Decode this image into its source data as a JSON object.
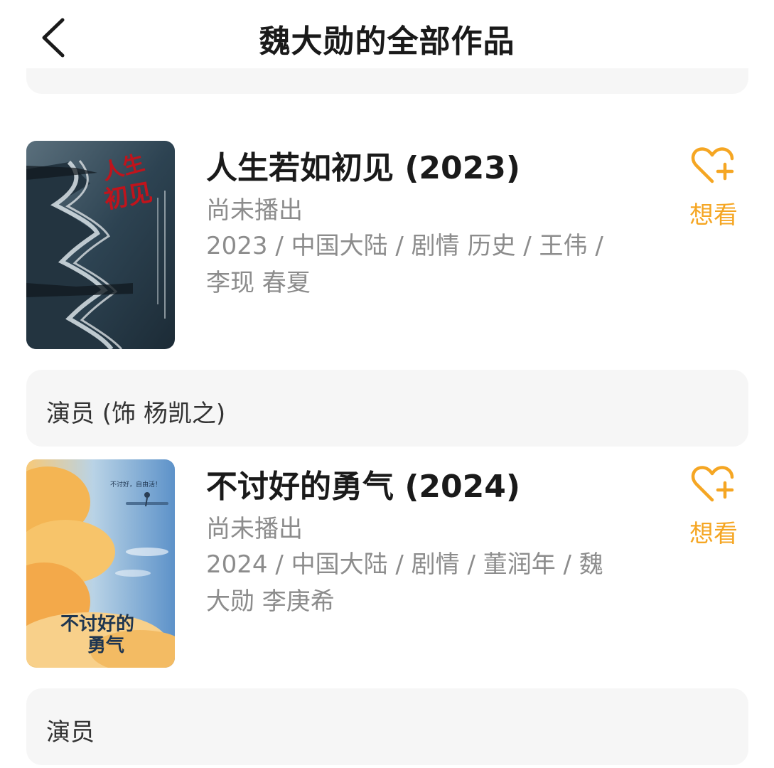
{
  "header": {
    "title": "魏大勋的全部作品"
  },
  "works": [
    {
      "title": "人生若如初见 (2023)",
      "status": "尚未播出",
      "meta": "2023 / 中国大陆 / 剧情 历史 / 王伟 / 李现 春夏",
      "want_label": "想看",
      "role": "演员 (饰 杨凯之)"
    },
    {
      "title": "不讨好的勇气 (2024)",
      "status": "尚未播出",
      "meta": "2024 / 中国大陆 / 剧情 / 董润年 / 魏大勋 李庚希",
      "want_label": "想看",
      "role": "演员"
    }
  ],
  "colors": {
    "accent": "#f5a623",
    "muted_text": "#8c8c8c",
    "panel_bg": "#f6f6f6"
  },
  "icons": {
    "back": "chevron-left-icon",
    "want": "heart-plus-icon"
  }
}
